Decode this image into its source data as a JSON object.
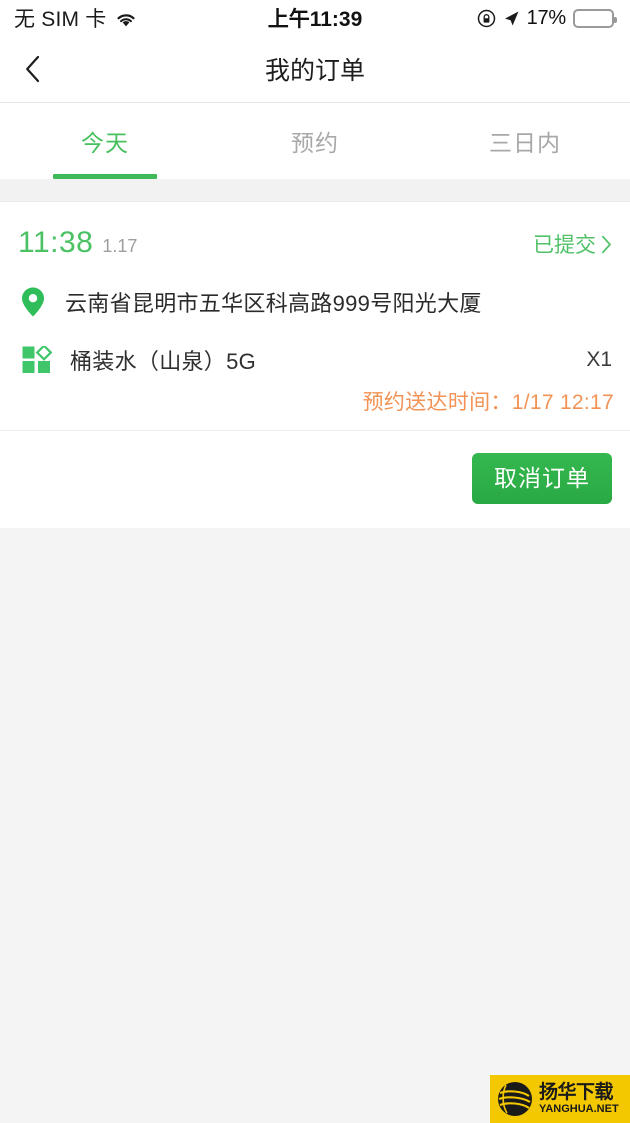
{
  "status_bar": {
    "carrier": "无 SIM 卡",
    "wifi_icon": "wifi-icon",
    "time": "上午11:39",
    "lock_icon": "rotation-lock-icon",
    "location_icon": "location-arrow-icon",
    "battery_percent": "17%",
    "battery_level": 17,
    "battery_color": "#f5c518"
  },
  "nav": {
    "back_icon": "chevron-left-icon",
    "title": "我的订单"
  },
  "tabs": {
    "items": [
      {
        "label": "今天",
        "active": true
      },
      {
        "label": "预约",
        "active": false
      },
      {
        "label": "三日内",
        "active": false
      }
    ],
    "active_color": "#47c05d",
    "inactive_color": "#a8a8a8",
    "indicator_color": "#3fb95a"
  },
  "order": {
    "time": "11:38",
    "date": "1.17",
    "status": "已提交",
    "status_chevron_icon": "chevron-right-icon",
    "address_icon": "map-pin-icon",
    "address": "云南省昆明市五华区科高路999号阳光大厦",
    "product_icon": "grid-squares-icon",
    "product_name": "桶装水（山泉）5G",
    "quantity": "X1",
    "eta_label": "预约送达时间：",
    "eta_value": "1/17 12:17",
    "eta_color": "#f29355",
    "cancel_label": "取消订单",
    "time_color": "#4ac163",
    "status_color": "#51c169"
  },
  "watermark": {
    "globe_icon": "globe-logo-icon",
    "cn_text": "扬华下载",
    "en_text": "YANGHUA.NET",
    "background": "#f4c800"
  }
}
